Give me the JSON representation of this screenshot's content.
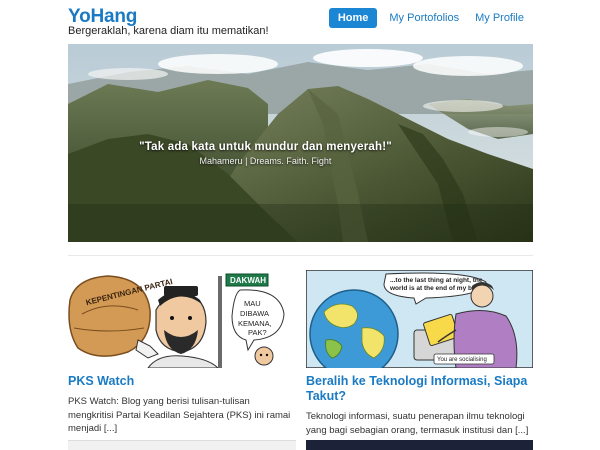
{
  "site": {
    "brand": "YoHang",
    "tagline": "Bergeraklah, karena diam itu mematikan!"
  },
  "nav": {
    "items": [
      {
        "label": "Home",
        "active": true
      },
      {
        "label": "My Portofolios",
        "active": false
      },
      {
        "label": "My Profile",
        "active": false
      }
    ]
  },
  "hero": {
    "quote": "\"Tak ada kata untuk mundur dan menyerah!\"",
    "caption": "Mahameru | Dreams. Faith. Fight"
  },
  "posts": [
    {
      "title": "PKS Watch",
      "excerpt": "PKS Watch: Blog yang berisi tulisan-tulisan mengkritisi Partai Keadilan Sejahtera (PKS) ini ramai menjadi [...]",
      "image_text": {
        "sack": "KEPENTINGAN PARTAI",
        "sign": "DAKWAH",
        "bubble": "MAU DIBAWA KEMANA, PAK?"
      }
    },
    {
      "title": "Beralih ke Teknologi Informasi, Siapa Takut?",
      "excerpt": "Teknologi informasi, suatu penerapan ilmu teknologi yang bagi sebagian orang, termasuk institusi dan [...]",
      "image_text": {
        "bubble": "...to the last thing at night, the world is at the end of my bed!",
        "caption": "You are socialising"
      }
    }
  ],
  "colors": {
    "accent": "#1a7bc4",
    "nav_active_bg": "#1a86d4"
  }
}
